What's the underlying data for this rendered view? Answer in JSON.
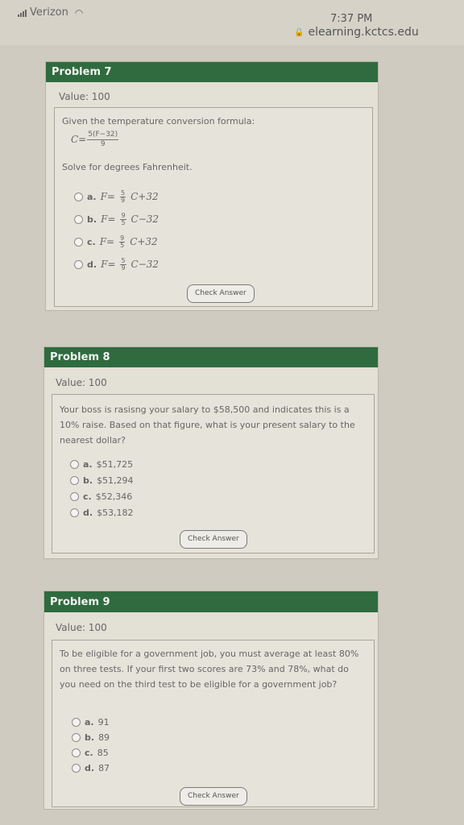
{
  "status": {
    "carrier": "Verizon",
    "time": "7:37 PM",
    "url": "elearning.kctcs.edu"
  },
  "problems": [
    {
      "title": "Problem 7",
      "value": "Value: 100",
      "question_intro": "Given the temperature conversion formula:",
      "formula_lhs": "C=",
      "formula_num": "5(F−32)",
      "formula_den": "9",
      "question_end": "Solve for degrees Fahrenheit.",
      "options": [
        {
          "letter": "a.",
          "lhs": "F=",
          "num": "5",
          "den": "9",
          "rest": "C+32"
        },
        {
          "letter": "b.",
          "lhs": "F=",
          "num": "9",
          "den": "5",
          "rest": "C−32"
        },
        {
          "letter": "c.",
          "lhs": "F=",
          "num": "9",
          "den": "5",
          "rest": "C+32"
        },
        {
          "letter": "d.",
          "lhs": "F=",
          "num": "5",
          "den": "9",
          "rest": "C−32"
        }
      ],
      "button": "Check Answer"
    },
    {
      "title": "Problem 8",
      "value": "Value: 100",
      "question": "Your boss is rasisng your salary to $58,500 and indicates this is a 10% raise. Based on that figure, what is your present salary to the nearest dollar?",
      "options": [
        {
          "letter": "a.",
          "text": "$51,725"
        },
        {
          "letter": "b.",
          "text": "$51,294"
        },
        {
          "letter": "c.",
          "text": "$52,346"
        },
        {
          "letter": "d.",
          "text": "$53,182"
        }
      ],
      "button": "Check Answer"
    },
    {
      "title": "Problem 9",
      "value": "Value: 100",
      "question": "To be eligible for a government job, you must average at least 80% on three tests. If your first two scores are 73% and 78%, what do you need on the third test to be eligible for a government job?",
      "options": [
        {
          "letter": "a.",
          "text": "91"
        },
        {
          "letter": "b.",
          "text": "89"
        },
        {
          "letter": "c.",
          "text": "85"
        },
        {
          "letter": "d.",
          "text": "87"
        }
      ],
      "button": "Check Answer"
    }
  ]
}
